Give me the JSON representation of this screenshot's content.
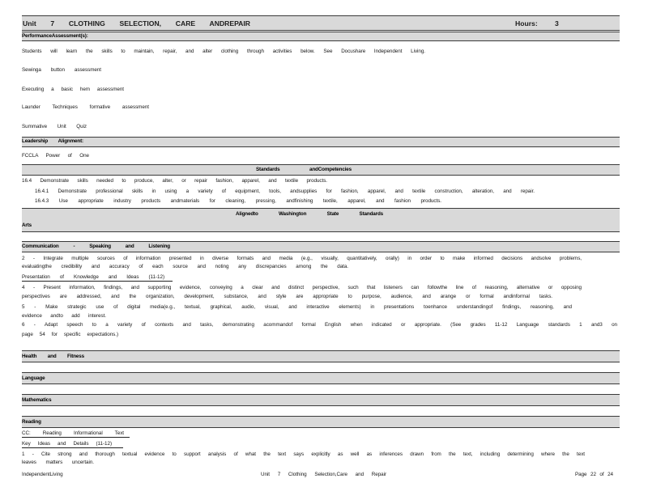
{
  "colors": {
    "band_fill": "#d9d9d9",
    "text": "#161616"
  },
  "header": {
    "title": "Unit 7 CLOTHING SELECTION, CARE ANDREPAIR",
    "hours_label": "Hours:",
    "hours_value": "3"
  },
  "performance": {
    "heading": "PerformanceAssessment(s):",
    "items": [
      "Students will learn the skills to maintain, repair, and alter clothing through activities below. See Docushare Independent Living.",
      "Sewinga button assessment",
      "Executing a basic hem assessment",
      "Launder Techniques formative assessment",
      "Summative Unit Quiz"
    ]
  },
  "leadership": {
    "heading": "Leadership Alignment:",
    "items": [
      "FCCLA Power of One"
    ]
  },
  "standards": {
    "heading": "Standards andCompetencies",
    "items": [
      "16.4 Demonstrate skills needed to produce, alter, or repair fashion, apparel, and textile products.",
      "16.4.1 Demonstrate professional skills in using a variety of equipment, tools, andsupplies for fashion, apparel, and textile construction, alteration, and repair.",
      "16.4.3 Use appropriate industry products andmaterials for cleaning, pressing, andfinishing textile, apparel, and fashion products."
    ]
  },
  "aligned_standards": {
    "heading": "Alignedto Washington State Standards",
    "subjects": {
      "arts": "Arts",
      "communication": "Communication - Speaking and Listening",
      "health": "Health and Fitness",
      "language": "Language",
      "mathematics": "Mathematics",
      "reading": "Reading"
    }
  },
  "communication": {
    "standard_2": [
      "2 - Integrate multiple sources of information presented in diverse formats and media (e.g., visually, quantitatively, orally) in order to make informed decisions andsolve problems,",
      "evaluatingthe credibility and accuracy of each source and noting any discrepancies among the data."
    ],
    "strand": "Presentation of Knowledge and Ideas (11-12)",
    "standard_4": [
      "4 - Present information, findings, and supporting evidence, conveying a clear and distinct perspective, such that listeners can followthe line of reasoning, alternative or opposing",
      "perspectives are addressed, and the organization, development, substance, and style are appropriate to purpose, audience, and arange or formal andinformal tasks."
    ],
    "standard_5": [
      "5 - Make strategic use of digital media(e.g., textual, graphical, audio, visual, and interactive elements) in presentations toenhance understandingof findings, reasoning, and",
      "evidence andto add interest."
    ],
    "standard_6": [
      "6 - Adapt speech to a variety of contexts and tasks, demonstrating acommandof formal English when indicated or appropriate. (See grades 11-12 Language standards 1 and3 on",
      "page 54 for specific expectations.)"
    ]
  },
  "reading": {
    "domain": "CC: Reading Informational Text",
    "strand": "Key Ideas and Details (11-12)",
    "standard_1": [
      "1 - Cite strong and thorough textual evidence to support analysis of what the text says explicitly as well as inferences drawn from the text, including determining where the text",
      "leaves matters uncertain."
    ]
  },
  "footer": {
    "course": "IndependentLiving",
    "unit": "Unit 7 Clothing Selection,Care and Repair",
    "page": "Page 22 of 24"
  }
}
